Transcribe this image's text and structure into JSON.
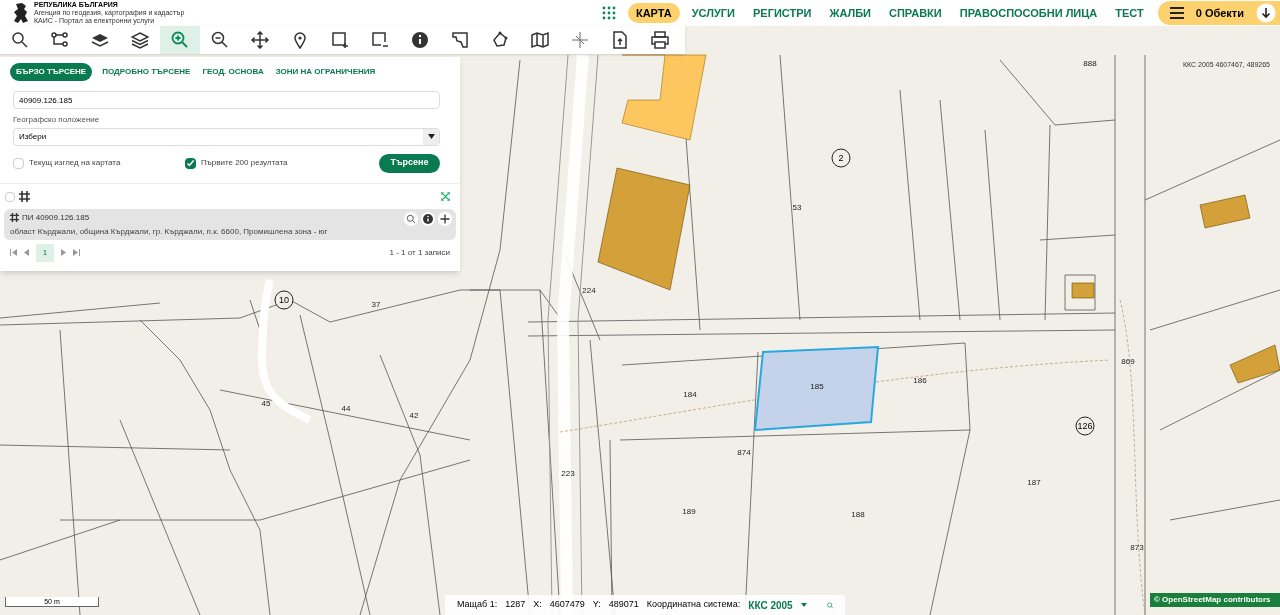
{
  "header": {
    "org_lines": [
      "РЕПУБЛИКА БЪЛГАРИЯ",
      "Агенция по геодезия, картография и кадастър",
      "КАИС - Портал за електронни услуги"
    ],
    "nav": [
      {
        "label": "КАРТА",
        "selected": true
      },
      {
        "label": "УСЛУГИ",
        "selected": false
      },
      {
        "label": "РЕГИСТРИ",
        "selected": false
      },
      {
        "label": "ЖАЛБИ",
        "selected": false
      },
      {
        "label": "СПРАВКИ",
        "selected": false
      },
      {
        "label": "ПРАВОСПОСОБНИ ЛИЦА",
        "selected": false
      },
      {
        "label": "ТЕСТ",
        "selected": false
      }
    ],
    "cart": {
      "label": "0 Обекти"
    }
  },
  "toolbar": [
    {
      "kind": "search",
      "selected": false
    },
    {
      "kind": "tree",
      "selected": false
    },
    {
      "kind": "layers-filled",
      "selected": false
    },
    {
      "kind": "layers",
      "selected": false
    },
    {
      "kind": "zoom-in",
      "selected": true
    },
    {
      "kind": "zoom-out",
      "selected": false
    },
    {
      "kind": "move",
      "selected": false
    },
    {
      "kind": "pin",
      "selected": false
    },
    {
      "kind": "rect-add",
      "selected": false
    },
    {
      "kind": "rect-remove",
      "selected": false
    },
    {
      "kind": "info",
      "selected": false
    },
    {
      "kind": "measure",
      "selected": false
    },
    {
      "kind": "polygon",
      "selected": false
    },
    {
      "kind": "map",
      "selected": false
    },
    {
      "kind": "split",
      "selected": false
    },
    {
      "kind": "document",
      "selected": false
    },
    {
      "kind": "print",
      "selected": false
    }
  ],
  "search_panel": {
    "tabs": [
      {
        "label": "БЪРЗО ТЪРСЕНЕ",
        "selected": true
      },
      {
        "label": "ПОДРОБНО ТЪРСЕНЕ",
        "selected": false
      },
      {
        "label": "ГЕОД. ОСНОВА",
        "selected": false
      },
      {
        "label": "ЗОНИ НА ОГРАНИЧЕНИЯ",
        "selected": false
      }
    ],
    "query": "40909.126.185",
    "location_label": "Географско положение",
    "location_value": "Избери",
    "options": [
      {
        "label": "Текущ изглед на картата",
        "checked": false
      },
      {
        "label": "Първите 200 резултата",
        "checked": true
      }
    ],
    "search_button": "Търсене",
    "select_all_checked": false,
    "results": [
      {
        "title": "ПИ 40909.126.185",
        "address": "област Кърджали, община Кърджали, гр. Кърджали, п.к. 6600, Промишлена зона - юг"
      }
    ],
    "pager": {
      "pages": [
        {
          "label": "1",
          "selected": true
        }
      ],
      "summary": "1 - 1 от 1 записи"
    }
  },
  "map": {
    "coordinates": "ККС 2005 4607467, 489265",
    "labels": [
      {
        "text": "2",
        "kind": "circle"
      },
      {
        "text": "10",
        "kind": "circle"
      },
      {
        "text": "126",
        "kind": "circle"
      },
      {
        "text": "874",
        "kind": "plain"
      },
      {
        "text": "869",
        "kind": "plain"
      },
      {
        "text": "873",
        "kind": "plain"
      },
      {
        "text": "888",
        "kind": "plain"
      },
      {
        "text": "185",
        "kind": "plain"
      },
      {
        "text": "186",
        "kind": "plain"
      },
      {
        "text": "184",
        "kind": "plain"
      },
      {
        "text": "189",
        "kind": "plain"
      },
      {
        "text": "188",
        "kind": "plain"
      },
      {
        "text": "187",
        "kind": "plain"
      },
      {
        "text": "224",
        "kind": "plain"
      },
      {
        "text": "223",
        "kind": "plain"
      },
      {
        "text": "37",
        "kind": "plain"
      },
      {
        "text": "45",
        "kind": "plain"
      },
      {
        "text": "44",
        "kind": "plain"
      },
      {
        "text": "42",
        "kind": "plain"
      },
      {
        "text": "53",
        "kind": "plain"
      }
    ],
    "scale": "50 m",
    "attribution": "© OpenStreetMap contributors"
  },
  "status_bar": {
    "scale_label": "Мащаб 1:",
    "scale_value": "1287",
    "x_label": "X:",
    "x_value": "4607479",
    "y_label": "Y:",
    "y_value": "489071",
    "crs_label": "Координатна система:",
    "crs_value": "ККС 2005"
  }
}
